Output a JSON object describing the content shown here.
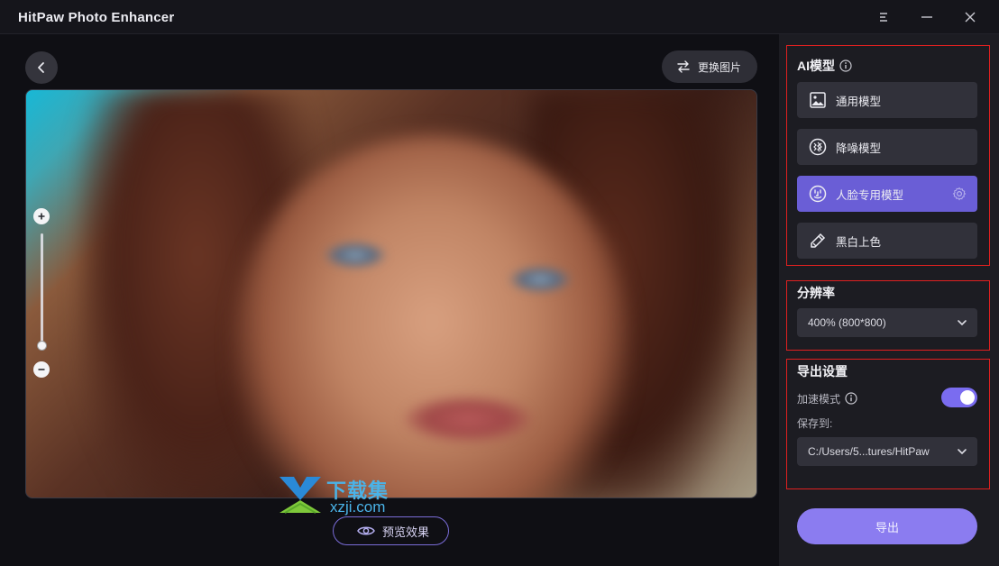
{
  "window": {
    "title": "HitPaw Photo Enhancer"
  },
  "toolbar": {
    "replace_label": "更换图片"
  },
  "image": {
    "zoom_level": 0.05
  },
  "watermark": {
    "cn": "下载集",
    "en": "xzji.com"
  },
  "preview": {
    "label": "预览效果"
  },
  "ai_models": {
    "title": "AI模型",
    "items": [
      {
        "label": "通用模型",
        "icon": "image-icon",
        "active": false
      },
      {
        "label": "降噪模型",
        "icon": "denoise-icon",
        "active": false
      },
      {
        "label": "人脸专用模型",
        "icon": "face-icon",
        "active": true
      },
      {
        "label": "黑白上色",
        "icon": "colorize-icon",
        "active": false
      }
    ]
  },
  "resolution": {
    "title": "分辨率",
    "value": "400% (800*800)"
  },
  "export_settings": {
    "title": "导出设置",
    "accel_label": "加速模式",
    "accel_on": true,
    "save_to_label": "保存到:",
    "save_path": "C:/Users/5...tures/HitPaw"
  },
  "export": {
    "label": "导出"
  },
  "colors": {
    "accent": "#6a5ed6",
    "export": "#8b7cf0",
    "highlight_box": "#e02020"
  }
}
